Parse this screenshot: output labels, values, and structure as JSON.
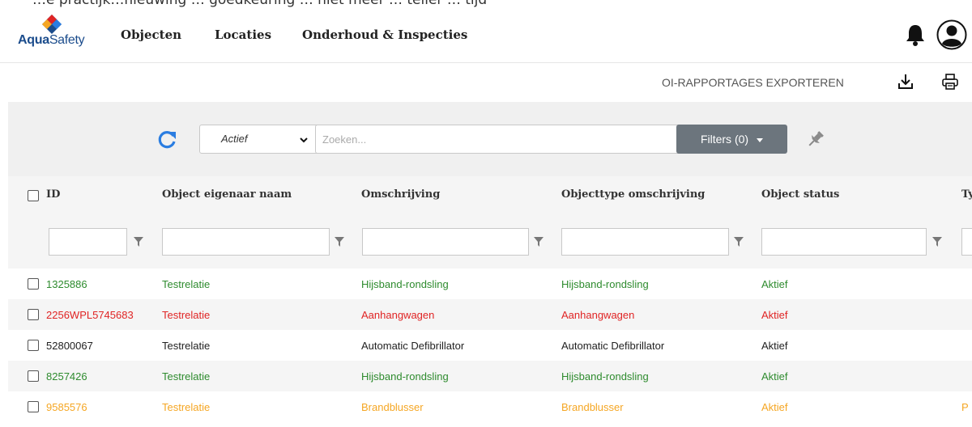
{
  "banner": {
    "text": "…e practijk…nieuwing … goedkeuring … niet meer … teller … tijd"
  },
  "brand": {
    "name_bold": "Aqua",
    "name_rest": "Safety"
  },
  "nav": {
    "items": [
      {
        "label": "Objecten"
      },
      {
        "label": "Locaties"
      },
      {
        "label": "Onderhoud & Inspecties"
      }
    ]
  },
  "export": {
    "label": "OI-RAPPORTAGES EXPORTEREN"
  },
  "toolbar": {
    "status_value": "Actief",
    "search_placeholder": "Zoeken...",
    "filters_label": "Filters (0)"
  },
  "table": {
    "columns": [
      {
        "label": "ID"
      },
      {
        "label": "Object eigenaar naam"
      },
      {
        "label": "Omschrijving"
      },
      {
        "label": "Objecttype omschrijving"
      },
      {
        "label": "Object status"
      },
      {
        "label": "Ty"
      }
    ],
    "rows": [
      {
        "color": "#2e8b2e",
        "cells": [
          "1325886",
          "Testrelatie",
          "Hijsband-rondsling",
          "Hijsband-rondsling",
          "Aktief",
          ""
        ]
      },
      {
        "color": "#e02424",
        "cells": [
          "2256WPL5745683",
          "Testrelatie",
          "Aanhangwagen",
          "Aanhangwagen",
          "Aktief",
          ""
        ]
      },
      {
        "color": "#222222",
        "cells": [
          "52800067",
          "Testrelatie",
          "Automatic Defibrillator",
          "Automatic Defibrillator",
          "Aktief",
          ""
        ]
      },
      {
        "color": "#2e8b2e",
        "cells": [
          "8257426",
          "Testrelatie",
          "Hijsband-rondsling",
          "Hijsband-rondsling",
          "Aktief",
          ""
        ]
      },
      {
        "color": "#f5a623",
        "cells": [
          "9585576",
          "Testrelatie",
          "Brandblusser",
          "Brandblusser",
          "Aktief",
          "P"
        ]
      }
    ]
  },
  "colors": {
    "accent_blue": "#1b4c8c",
    "refresh_blue": "#2a7de1",
    "button_gray": "#6c757d",
    "status_green": "#2e8b2e",
    "status_red": "#e02424",
    "status_orange": "#f5a623"
  },
  "icons": {
    "logo": "aquasafety-logo-icon",
    "bell": "bell-icon",
    "avatar": "user-avatar-icon",
    "download": "download-icon",
    "print": "print-icon",
    "refresh": "refresh-icon",
    "pin": "pin-icon",
    "filter": "funnel-icon"
  }
}
